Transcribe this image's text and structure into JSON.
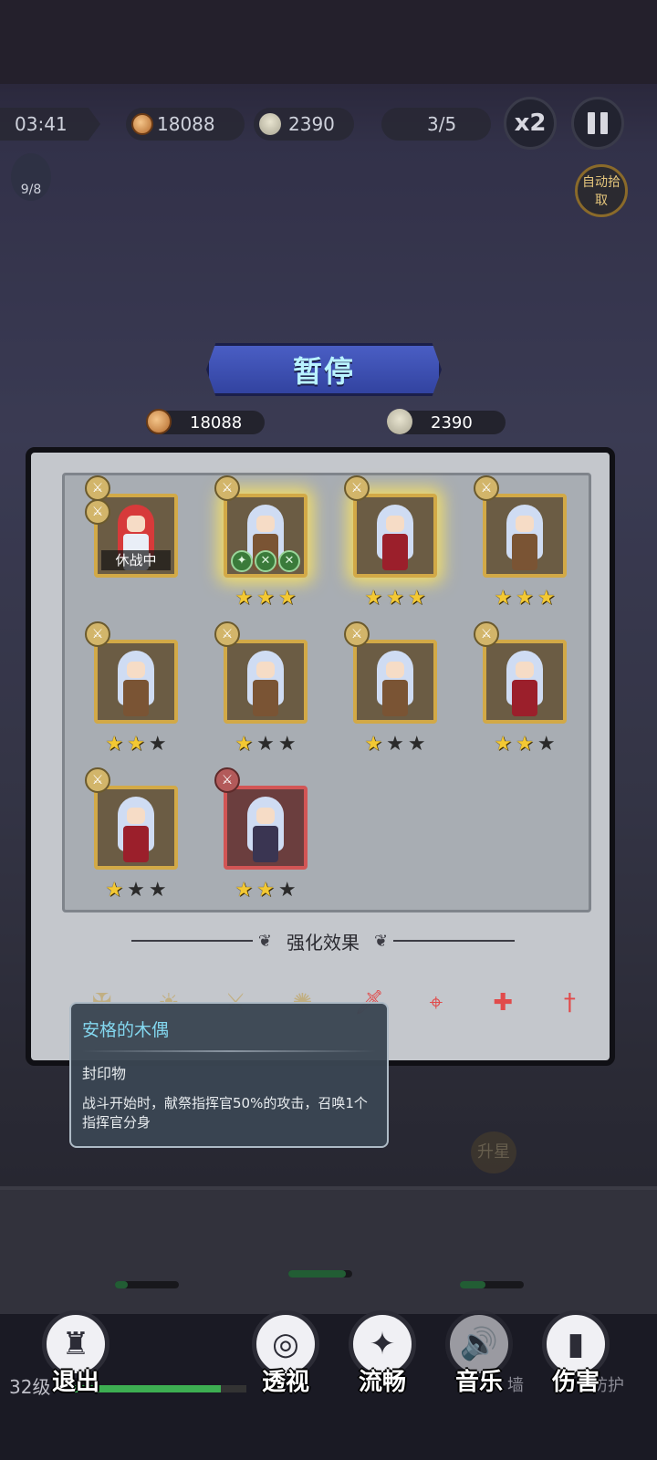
{
  "hud": {
    "timer": "03:41",
    "coins": "18088",
    "skulls": "2390",
    "wave": "3/5",
    "speed_label": "x2",
    "hero_count": "9/8",
    "auto_pickup_label": "自动拾取"
  },
  "pause": {
    "title": "暂停",
    "coins": "18088",
    "skulls": "2390"
  },
  "heroes": [
    {
      "stars_on": 0,
      "stars_total": 0,
      "status": "休战中",
      "badges": 2
    },
    {
      "stars_on": 3,
      "stars_total": 3,
      "glow": true,
      "buffs": [
        "✦",
        "✕",
        "✕"
      ]
    },
    {
      "stars_on": 3,
      "stars_total": 3,
      "glow": true
    },
    {
      "stars_on": 3,
      "stars_total": 3
    },
    {
      "stars_on": 2,
      "stars_total": 3
    },
    {
      "stars_on": 1,
      "stars_total": 3
    },
    {
      "stars_on": 1,
      "stars_total": 3
    },
    {
      "stars_on": 2,
      "stars_total": 3
    },
    {
      "stars_on": 1,
      "stars_total": 3
    },
    {
      "stars_on": 2,
      "stars_total": 3,
      "rare": true
    }
  ],
  "enhancements": {
    "title": "强化效果",
    "icons": [
      "crossbow-icon",
      "sun-emblem-icon",
      "sword-shine-icon",
      "aura-icon",
      "sword-icon",
      "crosshair-icon",
      "heal-drop-icon",
      "dagger-icon"
    ]
  },
  "tooltip": {
    "name": "安格的木偶",
    "type": "封印物",
    "description": "战斗开始时，献祭指挥官50%的攻击，召唤1个指挥官分身"
  },
  "field": {
    "star_up": "升星"
  },
  "bottom": {
    "level": "32级",
    "xp_fraction": 0.85,
    "exit": "退出",
    "xray": "透视",
    "smooth": "流畅",
    "music": "音乐",
    "damage": "伤害",
    "wall": "墙",
    "guard": "防护"
  },
  "colors": {
    "star_on": "#f3c833",
    "star_off": "#2b2b2b",
    "card_border": "#d2a947",
    "rare_border": "#d25555",
    "tooltip_name": "#83d7ef",
    "pause_banner": "#4a5ec4"
  }
}
